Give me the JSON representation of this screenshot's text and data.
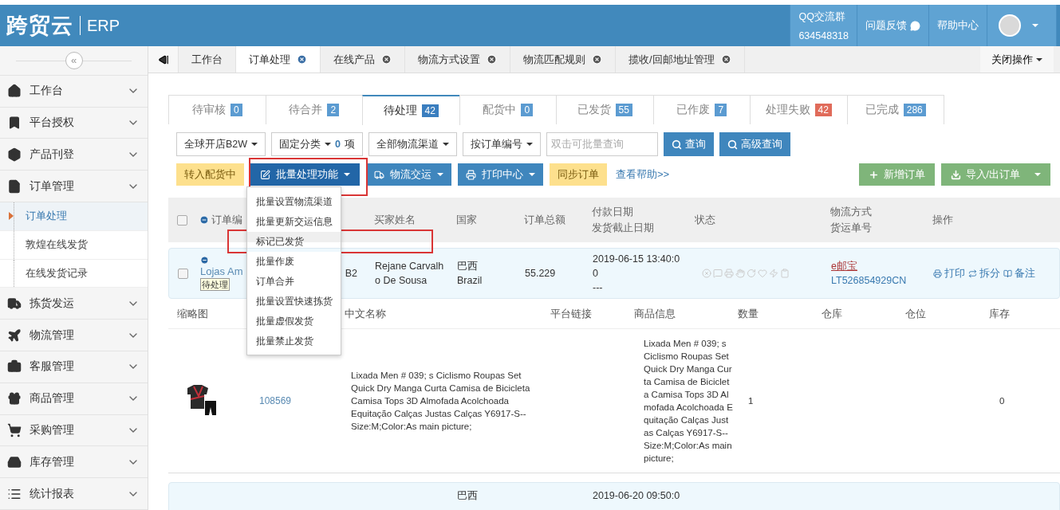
{
  "header": {
    "logo": "跨贸云",
    "product": "ERP",
    "qq_group": {
      "label": "QQ交流群",
      "number": "634548318"
    },
    "links": [
      {
        "label": "问题反馈",
        "kind": "feedback"
      },
      {
        "label": "帮助中心",
        "kind": "plain"
      }
    ]
  },
  "sidebar": {
    "collapse": "«",
    "items": [
      {
        "label": "工作台"
      },
      {
        "label": "平台授权"
      },
      {
        "label": "产品刊登"
      },
      {
        "label": "订单管理",
        "children": [
          {
            "label": "订单处理",
            "selected": true
          },
          {
            "label": "敦煌在线发货",
            "selected": false
          },
          {
            "label": "在线发货记录",
            "selected": false
          }
        ]
      },
      {
        "label": "拣货发运"
      },
      {
        "label": "物流管理"
      },
      {
        "label": "客服管理"
      },
      {
        "label": "商品管理"
      },
      {
        "label": "采购管理"
      },
      {
        "label": "库存管理"
      },
      {
        "label": "统计报表"
      }
    ]
  },
  "page_tabs": {
    "items": [
      {
        "label": "工作台",
        "selected": false,
        "closable": false
      },
      {
        "label": "订单处理",
        "selected": true,
        "closable": true
      },
      {
        "label": "在线产品",
        "selected": false,
        "closable": true
      },
      {
        "label": "物流方式设置",
        "selected": false,
        "closable": true
      },
      {
        "label": "物流匹配规则",
        "selected": false,
        "closable": true
      },
      {
        "label": "揽收/回邮地址管理",
        "selected": false,
        "closable": true
      }
    ],
    "close_menu": "关闭操作"
  },
  "status_tabs": [
    {
      "label": "待审核",
      "count": "0",
      "color": "#5b9bd1",
      "selected": false
    },
    {
      "label": "待合并",
      "count": "2",
      "color": "#5b9bd1",
      "selected": false
    },
    {
      "label": "待处理",
      "count": "42",
      "color": "#3a7ebf",
      "selected": true
    },
    {
      "label": "配货中",
      "count": "0",
      "color": "#5b9bd1",
      "selected": false
    },
    {
      "label": "已发货",
      "count": "55",
      "color": "#5b9bd1",
      "selected": false
    },
    {
      "label": "已作废",
      "count": "7",
      "color": "#5b9bd1",
      "selected": false
    },
    {
      "label": "处理失败",
      "count": "42",
      "color": "#e06b5a",
      "selected": false
    },
    {
      "label": "已完成",
      "count": "286",
      "color": "#5b9bd1",
      "selected": false
    }
  ],
  "filters": {
    "store": "全球开店B2W",
    "category": {
      "label": "固定分类",
      "count": "0",
      "unit": "项"
    },
    "channel": "全部物流渠道",
    "search_by": "按订单编号",
    "search": {
      "placeholder": "双击可批量查询"
    },
    "query": "查询",
    "advanced": "高级查询"
  },
  "actions": [
    {
      "label": "转入配货中",
      "kind": "yellow",
      "dropdown": false,
      "highlighted": false
    },
    {
      "label": "批量处理功能",
      "kind": "darkblue",
      "dropdown": true,
      "highlighted": true
    },
    {
      "label": "物流交运",
      "kind": "blue",
      "dropdown": true,
      "highlighted": false
    },
    {
      "label": "打印中心",
      "kind": "blue",
      "dropdown": true,
      "highlighted": false
    },
    {
      "label": "同步订单",
      "kind": "yellow",
      "dropdown": false,
      "highlighted": false
    }
  ],
  "help_link": "查看帮助>>",
  "right_actions": [
    {
      "label": "新增订单",
      "dropdown": false
    },
    {
      "label": "导入/出订单",
      "dropdown": true
    }
  ],
  "batch_menu": [
    {
      "label": "批量设置物流渠道",
      "highlighted": false
    },
    {
      "label": "批量更新交运信息",
      "highlighted": false
    },
    {
      "label": "标记已发货",
      "highlighted": true
    },
    {
      "label": "批量作废",
      "highlighted": false
    },
    {
      "label": "订单合并",
      "highlighted": false
    },
    {
      "label": "批量设置快速拣货",
      "highlighted": false
    },
    {
      "label": "批量虚假发货",
      "highlighted": false
    },
    {
      "label": "批量禁止发货",
      "highlighted": false
    }
  ],
  "table": {
    "all_checked": false,
    "columns": [
      {
        "lines": [
          "订单编"
        ]
      },
      {
        "lines": [
          "买家姓名"
        ]
      },
      {
        "lines": [
          "国家"
        ]
      },
      {
        "lines": [
          "订单总额"
        ]
      },
      {
        "lines": [
          "付款日期",
          "发货截止日期"
        ]
      },
      {
        "lines": [
          "状态"
        ]
      },
      {
        "lines": [
          "物流方式",
          "货运单号"
        ]
      },
      {
        "lines": [
          "操作"
        ]
      }
    ],
    "orders": [
      {
        "checked": false,
        "order_no": "Lojas Am",
        "status_tag": "待处理",
        "store": "B2",
        "buyer": "Rejane Carvalho De Sousa",
        "country": "巴西",
        "country_en": "Brazil",
        "total": "55.229",
        "paid": "2019-06-15 13:40:00",
        "deadline": "---",
        "carrier": "e邮宝",
        "tracking": "LT526854929CN",
        "ops": [
          "打印",
          "拆分",
          "备注"
        ],
        "item_columns": [
          "缩略图",
          "",
          "中文名称",
          "平台链接",
          "商品信息",
          "数量",
          "仓库",
          "仓位",
          "库存"
        ],
        "items": [
          {
            "code": "108569",
            "name": "Lixada Men # 039; s Ciclismo Roupas Set Quick Dry Manga Curta Camisa de Bicicleta Camisa Tops 3D Almofada Acolchoada Equitação Calças Justas Calças Y6917-S--Size:M;Color:As main picture;",
            "info": "Lixada Men # 039; s Ciclismo Roupas Set Quick Dry Manga Curta Camisa de Bicicleta Camisa Tops 3D Almofada Acolchoada Equitação Calças Justas Calças Y6917-S--Size:M;Color:As main picture;",
            "quantity": "1",
            "stock": "0"
          }
        ]
      },
      {
        "country": "巴西",
        "paid": "2019-06-20 09:50:0"
      }
    ]
  }
}
